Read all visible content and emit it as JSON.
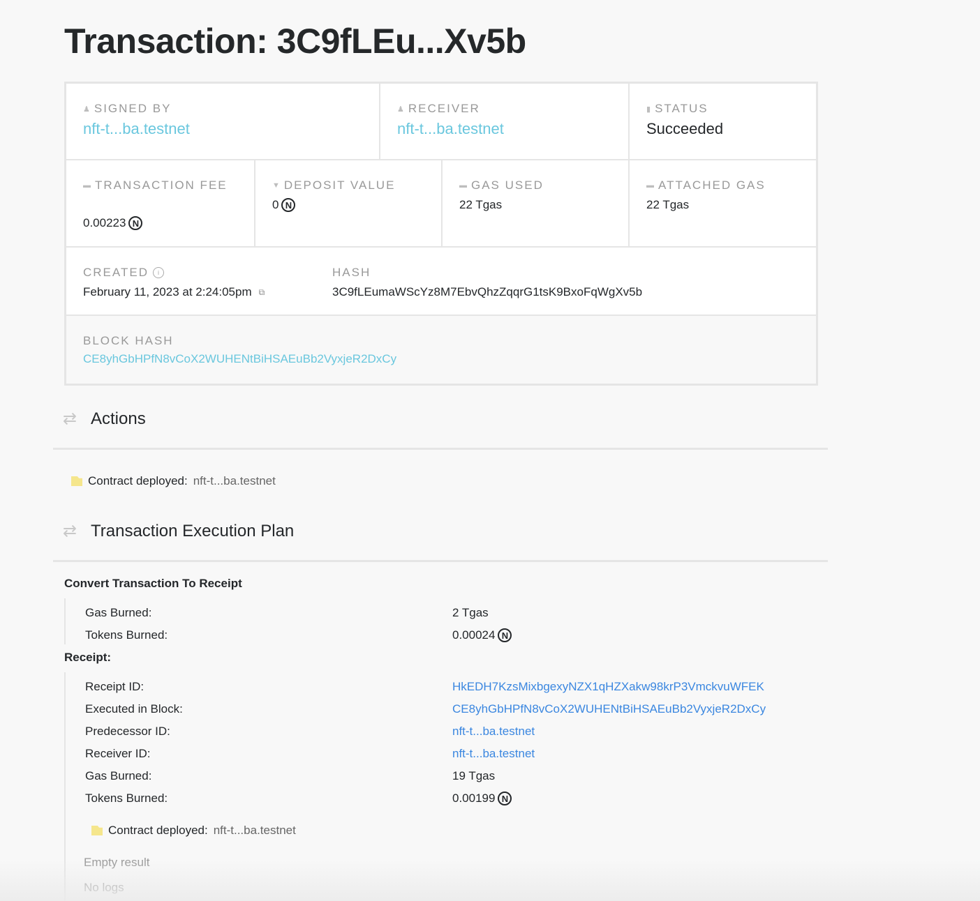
{
  "page": {
    "title": "Transaction: 3C9fLEu...Xv5b"
  },
  "summary": {
    "signed_by": {
      "label": "SIGNED BY",
      "icon": "person-icon",
      "value": "nft-t...ba.testnet"
    },
    "receiver": {
      "label": "RECEIVER",
      "icon": "person-icon",
      "value": "nft-t...ba.testnet"
    },
    "status": {
      "label": "STATUS",
      "icon": "comment-icon",
      "value": "Succeeded"
    },
    "transaction_fee": {
      "label": "TRANSACTION FEE",
      "icon": "database-icon",
      "value": "0.00223",
      "unit_icon": "Ⓝ"
    },
    "deposit_value": {
      "label": "DEPOSIT VALUE",
      "icon": "filter-icon",
      "value": "0",
      "unit_icon": "Ⓝ"
    },
    "gas_used": {
      "label": "GAS USED",
      "icon": "database-icon",
      "value": "22 Tgas"
    },
    "attached_gas": {
      "label": "ATTACHED GAS",
      "icon": "database-icon",
      "value": "22 Tgas"
    },
    "created": {
      "label": "CREATED",
      "icon": "info-icon",
      "value": "February 11, 2023 at 2:24:05pm"
    },
    "hash": {
      "label": "HASH",
      "value": "3C9fLEumaWScYz8M7EbvQhzZqqrG1tsK9BxoFqWgXv5b"
    },
    "block_hash": {
      "label": "BLOCK HASH",
      "value": "CE8yhGbHPfN8vCoX2WUHENtBiHSAEuBb2VyxjeR2DxCy"
    }
  },
  "actions": {
    "title": "Actions",
    "items": [
      {
        "label": "Contract deployed:",
        "account": "nft-t...ba.testnet"
      }
    ]
  },
  "execution_plan": {
    "title": "Transaction Execution Plan",
    "convert": {
      "heading": "Convert Transaction To Receipt",
      "rows": [
        {
          "key": "Gas Burned:",
          "value": "2 Tgas"
        },
        {
          "key": "Tokens Burned:",
          "value": "0.00024",
          "unit_icon": "Ⓝ"
        }
      ]
    },
    "receipt": {
      "heading": "Receipt:",
      "rows": [
        {
          "key": "Receipt ID:",
          "value": "HkEDH7KzsMixbgexyNZX1qHZXakw98krP3VmckvuWFEK"
        },
        {
          "key": "Executed in Block:",
          "value": "CE8yhGbHPfN8vCoX2WUHENtBiHSAEuBb2VyxjeR2DxCy"
        },
        {
          "key": "Predecessor ID:",
          "value": "nft-t...ba.testnet"
        },
        {
          "key": "Receiver ID:",
          "value": "nft-t...ba.testnet"
        },
        {
          "key": "Gas Burned:",
          "value": "19 Tgas"
        },
        {
          "key": "Tokens Burned:",
          "value": "0.00199",
          "unit_icon": "Ⓝ"
        }
      ],
      "action": {
        "label": "Contract deployed:",
        "account": "nft-t...ba.testnet"
      },
      "result": "Empty result",
      "logs": "No logs"
    }
  },
  "colors": {
    "link_cyan": "#6ac7de",
    "link_blue": "#3b87e0",
    "muted": "#999999",
    "border": "#e5e5e5"
  }
}
